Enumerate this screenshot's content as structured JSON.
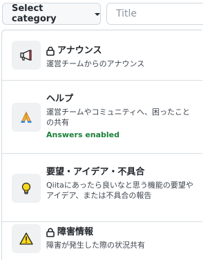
{
  "toolbar": {
    "select_category_label": "Select category",
    "title_placeholder": "Title"
  },
  "categories": [
    {
      "icon": "megaphone-icon",
      "locked": true,
      "title": "アナウンス",
      "description": "運営チームからのアナウンス"
    },
    {
      "icon": "folded-hands-icon",
      "locked": false,
      "title": "ヘルプ",
      "description": "運営チームやコミュニティへ、困ったことの共有",
      "badge": "Answers enabled"
    },
    {
      "icon": "lightbulb-icon",
      "locked": false,
      "title": "要望・アイデア・不具合",
      "description": "Qiitaにあったら良いなと思う機能の要望やアイデア、または不具合の報告"
    },
    {
      "icon": "warning-icon",
      "locked": true,
      "title": "障害情報",
      "description": "障害が発生した際の状況共有"
    }
  ],
  "colors": {
    "border": "#d0d7de",
    "icon_background": "#eff1f3",
    "answers_green": "#1a7f37"
  }
}
